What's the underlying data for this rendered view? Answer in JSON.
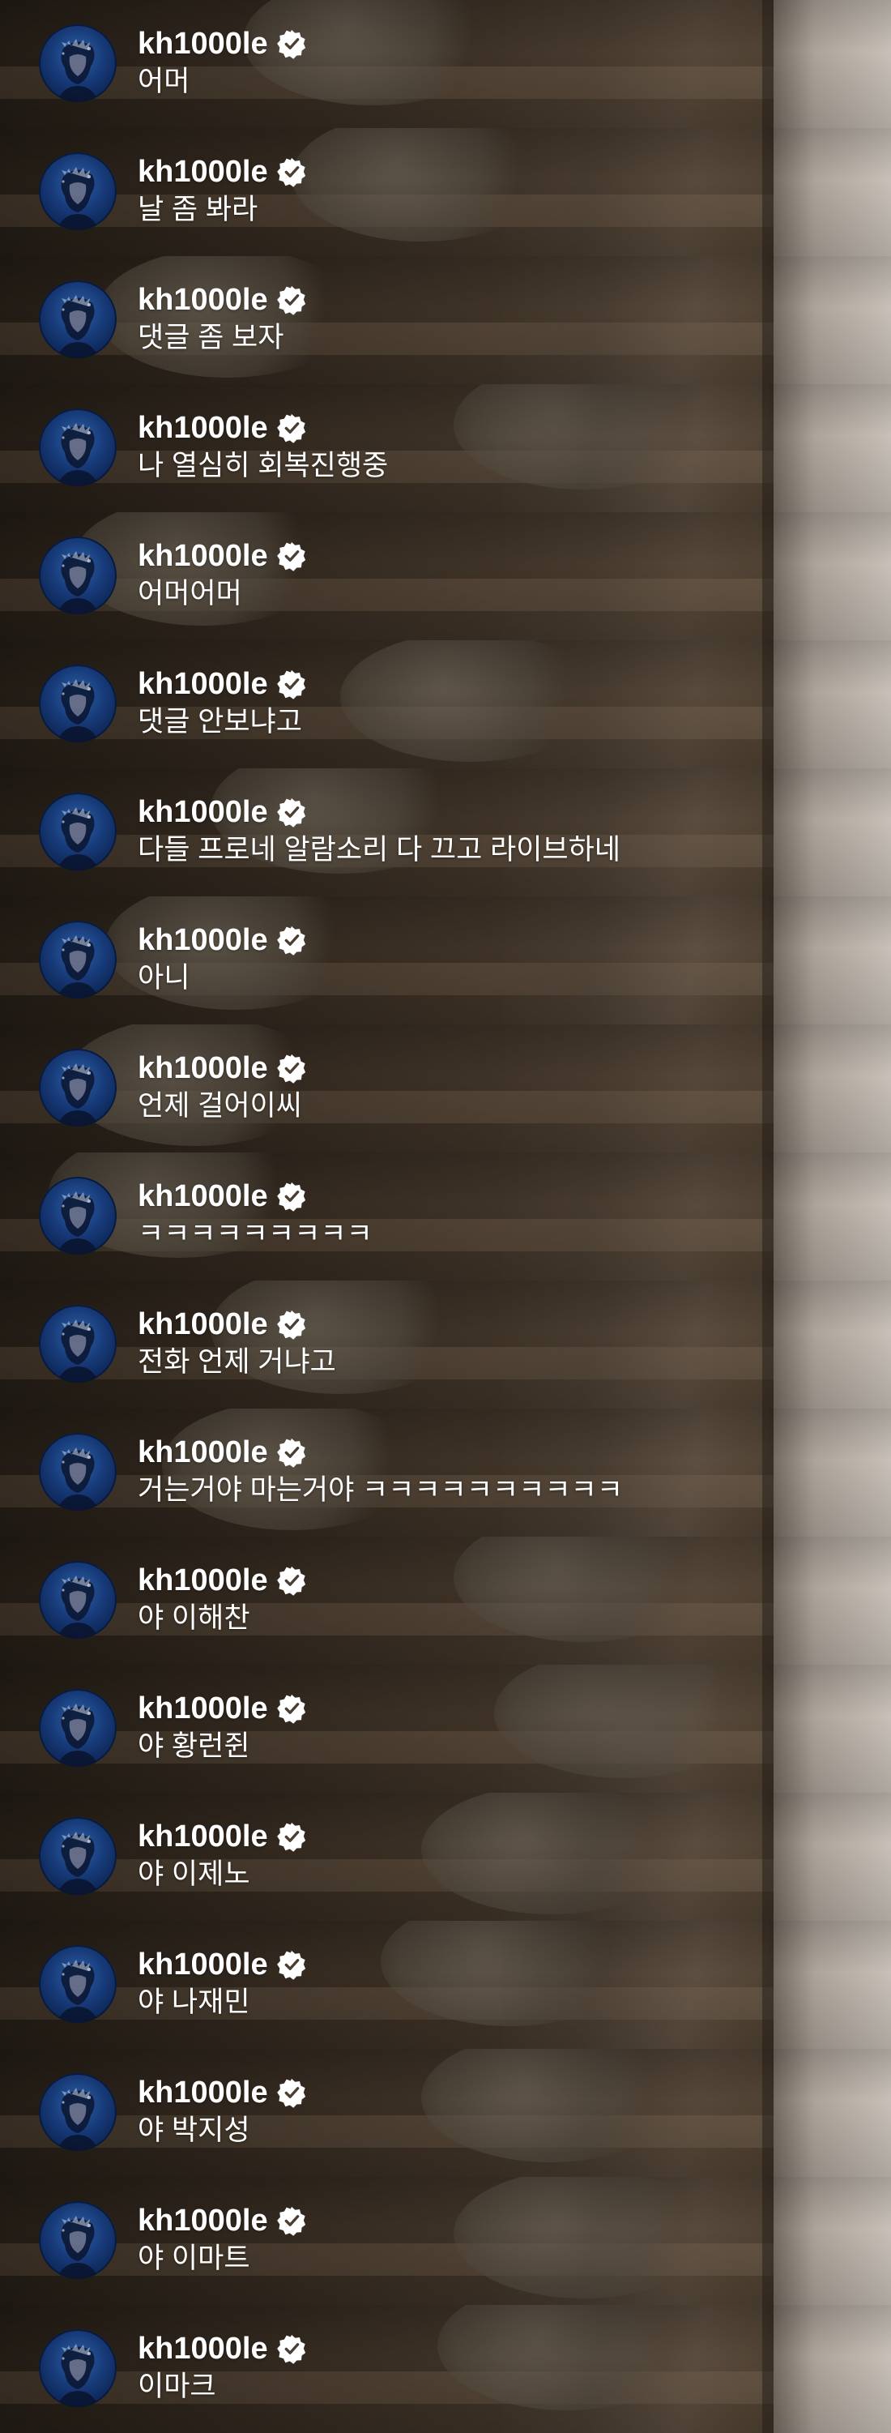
{
  "comments": [
    {
      "user": "kh1000le",
      "text": "어머"
    },
    {
      "user": "kh1000le",
      "text": "날 좀 봐라"
    },
    {
      "user": "kh1000le",
      "text": "댓글 좀 보자"
    },
    {
      "user": "kh1000le",
      "text": "나 열심히 회복진행중"
    },
    {
      "user": "kh1000le",
      "text": "어머어머"
    },
    {
      "user": "kh1000le",
      "text": "댓글 안보냐고"
    },
    {
      "user": "kh1000le",
      "text": "다들 프로네 알람소리 다 끄고 라이브하네"
    },
    {
      "user": "kh1000le",
      "text": "아니"
    },
    {
      "user": "kh1000le",
      "text": "언제 걸어이씨"
    },
    {
      "user": "kh1000le",
      "text": "ㅋㅋㅋㅋㅋㅋㅋㅋㅋ"
    },
    {
      "user": "kh1000le",
      "text": "전화 언제 거냐고"
    },
    {
      "user": "kh1000le",
      "text": "거는거야 마는거야 ㅋㅋㅋㅋㅋㅋㅋㅋㅋㅋ"
    },
    {
      "user": "kh1000le",
      "text": "야 이해찬"
    },
    {
      "user": "kh1000le",
      "text": "야 황런쥔"
    },
    {
      "user": "kh1000le",
      "text": "야 이제노"
    },
    {
      "user": "kh1000le",
      "text": "야 나재민"
    },
    {
      "user": "kh1000le",
      "text": "야 박지성"
    },
    {
      "user": "kh1000le",
      "text": "야 이마트"
    },
    {
      "user": "kh1000le",
      "text": "이마크"
    }
  ],
  "icons": {
    "avatar": "profile-avatar",
    "verified": "verified-badge-icon"
  }
}
